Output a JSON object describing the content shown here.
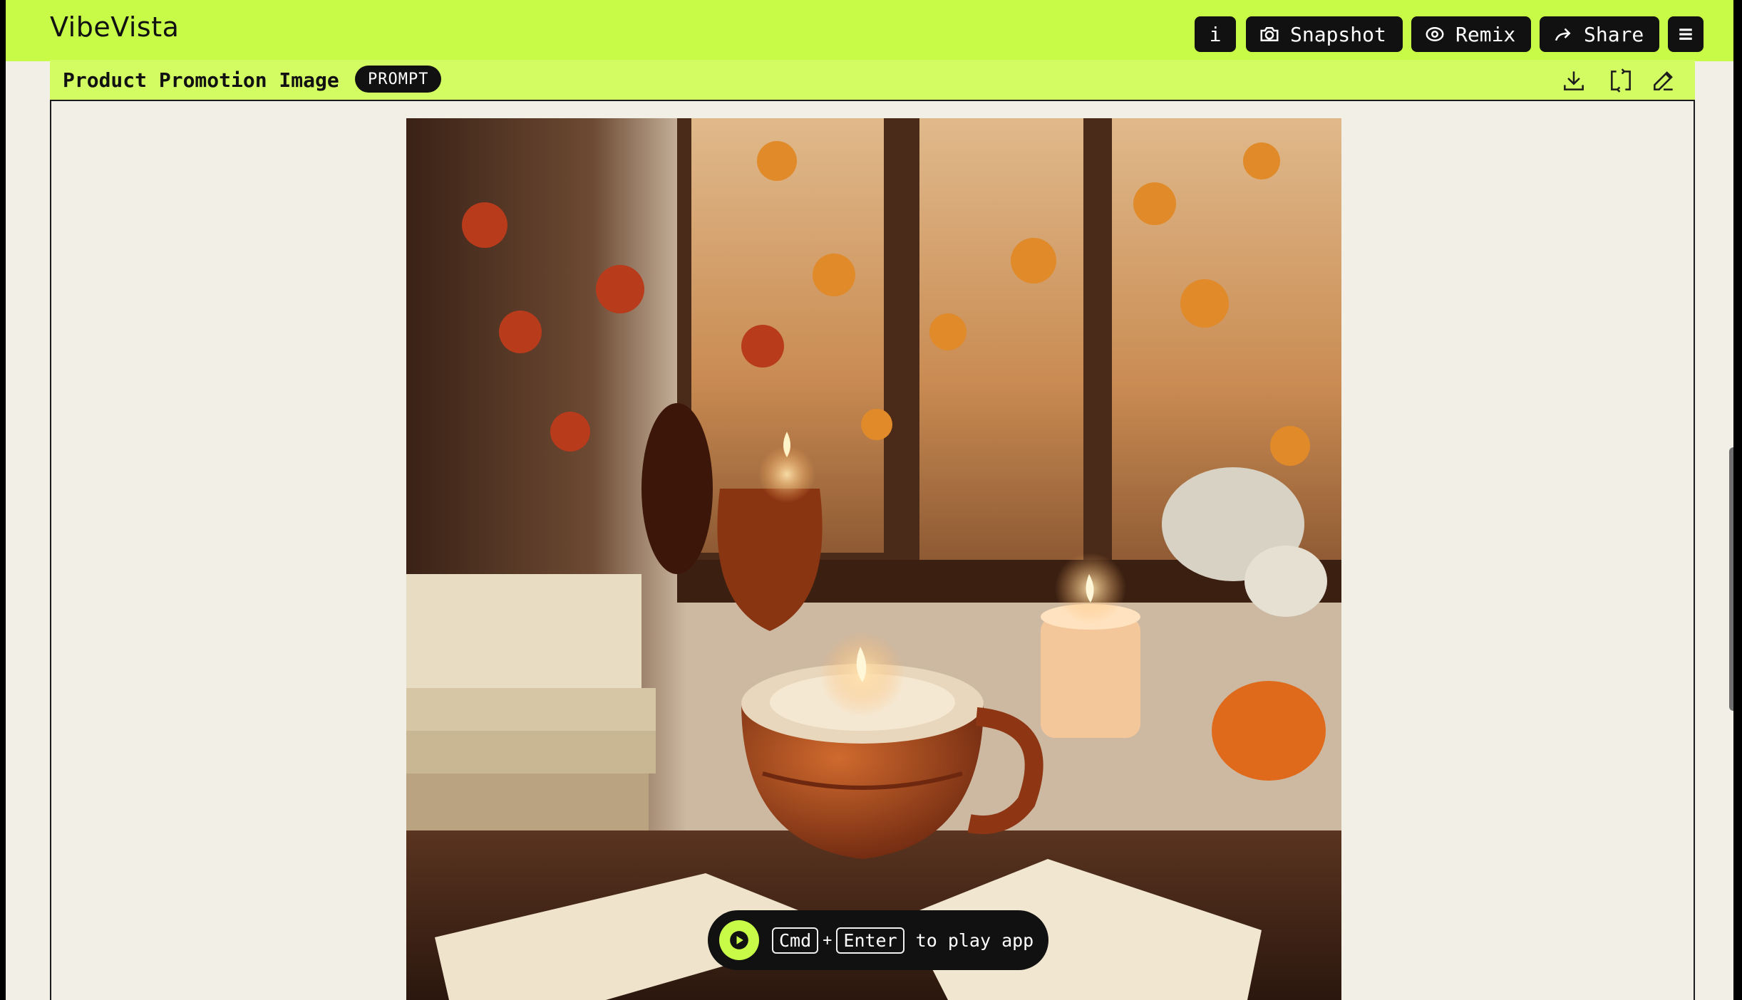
{
  "app": {
    "title": "VibeVista"
  },
  "toolbar": {
    "info_label": "i",
    "snapshot_label": "Snapshot",
    "remix_label": "Remix",
    "share_label": "Share",
    "icons": {
      "info": "info-icon",
      "snapshot": "camera-icon",
      "remix": "remix-icon",
      "share": "share-arrow-icon",
      "menu": "hamburger-menu-icon"
    }
  },
  "card": {
    "title": "Product Promotion Image",
    "badge": "PROMPT",
    "actions": [
      "download-icon",
      "refresh-icon",
      "edit-icon"
    ]
  },
  "play_hint": {
    "key1": "Cmd",
    "plus": "+",
    "key2": "Enter",
    "text": "to play app"
  },
  "colors": {
    "accent": "#c8fb48",
    "header": "#d3fc62",
    "background": "#f1efe6",
    "dark": "#111111"
  }
}
